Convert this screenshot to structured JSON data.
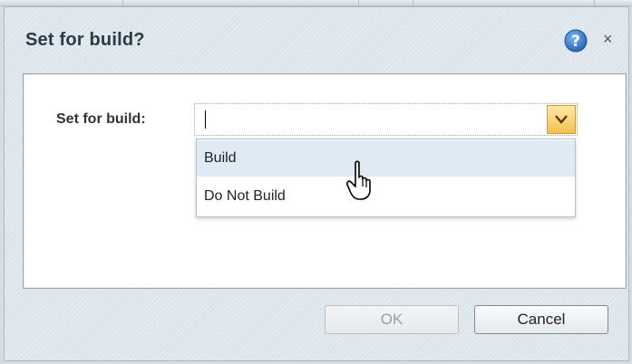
{
  "dialog": {
    "title": "Set for build?",
    "help_icon": "question-circle-icon",
    "close_symbol": "×"
  },
  "form": {
    "label": "Set for build:",
    "combo_value": "",
    "dropdown_icon": "chevron-down-icon",
    "options": [
      {
        "label": "Build",
        "hovered": true
      },
      {
        "label": "Do Not Build",
        "hovered": false
      }
    ]
  },
  "buttons": {
    "ok_label": "OK",
    "ok_enabled": false,
    "cancel_label": "Cancel"
  },
  "cursor": {
    "icon": "hand-pointer-icon"
  },
  "colors": {
    "accent_dropdown": "#f7c04e",
    "hover_option": "#dfeaf4",
    "help_icon_blue": "#2f6fc2"
  }
}
